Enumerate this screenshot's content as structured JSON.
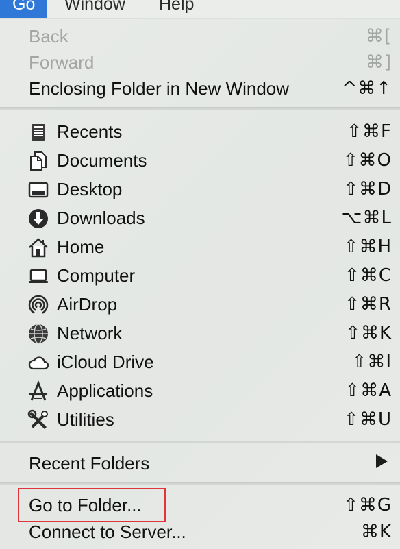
{
  "menubar": {
    "items": [
      "Go",
      "Window",
      "Help"
    ]
  },
  "menu": {
    "nav": [
      {
        "label": "Back",
        "shortcut": "⌘[",
        "disabled": true
      },
      {
        "label": "Forward",
        "shortcut": "⌘]",
        "disabled": true
      },
      {
        "label": "Enclosing Folder in New Window",
        "shortcut": "^⌘↑",
        "disabled": false
      }
    ],
    "places": [
      {
        "label": "Recents",
        "shortcut": "⇧⌘F",
        "icon": "recents-icon"
      },
      {
        "label": "Documents",
        "shortcut": "⇧⌘O",
        "icon": "documents-icon"
      },
      {
        "label": "Desktop",
        "shortcut": "⇧⌘D",
        "icon": "desktop-icon"
      },
      {
        "label": "Downloads",
        "shortcut": "⌥⌘L",
        "icon": "downloads-icon"
      },
      {
        "label": "Home",
        "shortcut": "⇧⌘H",
        "icon": "home-icon"
      },
      {
        "label": "Computer",
        "shortcut": "⇧⌘C",
        "icon": "computer-icon"
      },
      {
        "label": "AirDrop",
        "shortcut": "⇧⌘R",
        "icon": "airdrop-icon"
      },
      {
        "label": "Network",
        "shortcut": "⇧⌘K",
        "icon": "network-icon"
      },
      {
        "label": "iCloud Drive",
        "shortcut": "⇧⌘I",
        "icon": "icloud-icon"
      },
      {
        "label": "Applications",
        "shortcut": "⇧⌘A",
        "icon": "applications-icon"
      },
      {
        "label": "Utilities",
        "shortcut": "⇧⌘U",
        "icon": "utilities-icon"
      }
    ],
    "recent_folders": {
      "label": "Recent Folders"
    },
    "go_to_folder": {
      "label": "Go to Folder...",
      "shortcut": "⇧⌘G"
    },
    "connect": {
      "label": "Connect to Server...",
      "shortcut": "⌘K"
    }
  },
  "colors": {
    "menubar_active": "#2f78d8",
    "highlight_box": "#e0353b",
    "disabled_text": "#a3a6a3"
  }
}
